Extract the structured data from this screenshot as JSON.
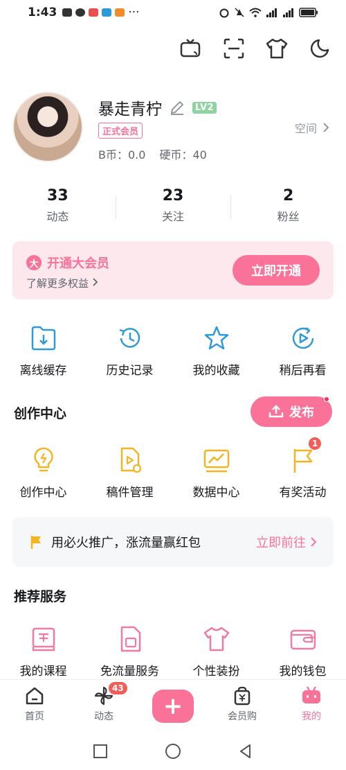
{
  "status_bar": {
    "time": "1:43",
    "dots": "···",
    "battery": ""
  },
  "profile": {
    "username": "暴走青柠",
    "level": "LV2",
    "vip_tag": "正式会员",
    "b_coin": "B币：0.0",
    "coin": "硬币：40",
    "space_link": "空间"
  },
  "stats": [
    {
      "num": "33",
      "label": "动态"
    },
    {
      "num": "23",
      "label": "关注"
    },
    {
      "num": "2",
      "label": "粉丝"
    }
  ],
  "vip_card": {
    "badge": "大",
    "title": "开通大会员",
    "subtitle": "了解更多权益",
    "button": "立即开通"
  },
  "quick_actions": [
    {
      "label": "离线缓存",
      "icon": "download-folder-icon"
    },
    {
      "label": "历史记录",
      "icon": "history-clock-icon"
    },
    {
      "label": "我的收藏",
      "icon": "star-icon"
    },
    {
      "label": "稍后再看",
      "icon": "watch-later-icon"
    }
  ],
  "creation": {
    "title": "创作中心",
    "publish": "发布",
    "items": [
      {
        "label": "创作中心",
        "icon": "bulb-icon"
      },
      {
        "label": "稿件管理",
        "icon": "manuscript-icon"
      },
      {
        "label": "数据中心",
        "icon": "chart-icon"
      },
      {
        "label": "有奖活动",
        "icon": "flag-icon",
        "badge": "1"
      }
    ]
  },
  "promo": {
    "text": "用必火推广，涨流量赢红包",
    "link": "立即前往"
  },
  "services": {
    "title": "推荐服务",
    "items": [
      {
        "label": "我的课程",
        "icon": "course-icon"
      },
      {
        "label": "免流量服务",
        "icon": "sim-card-icon"
      },
      {
        "label": "个性装扮",
        "icon": "tshirt-icon"
      },
      {
        "label": "我的钱包",
        "icon": "wallet-icon"
      }
    ]
  },
  "tabbar": [
    {
      "label": "首页",
      "icon": "home-icon"
    },
    {
      "label": "动态",
      "icon": "pinwheel-icon",
      "badge": "43"
    },
    {
      "label": "",
      "icon": "plus-icon"
    },
    {
      "label": "会员购",
      "icon": "shopping-bag-icon"
    },
    {
      "label": "我的",
      "icon": "tv-mascot-icon",
      "active": true
    }
  ],
  "colors": {
    "accent": "#fb7299",
    "text": "#18191c",
    "secondary": "#61666d",
    "muted": "#9499a0",
    "icon_blue": "#2f9ad8",
    "icon_yellow": "#f5b521",
    "level_green": "#8fd3a3"
  }
}
